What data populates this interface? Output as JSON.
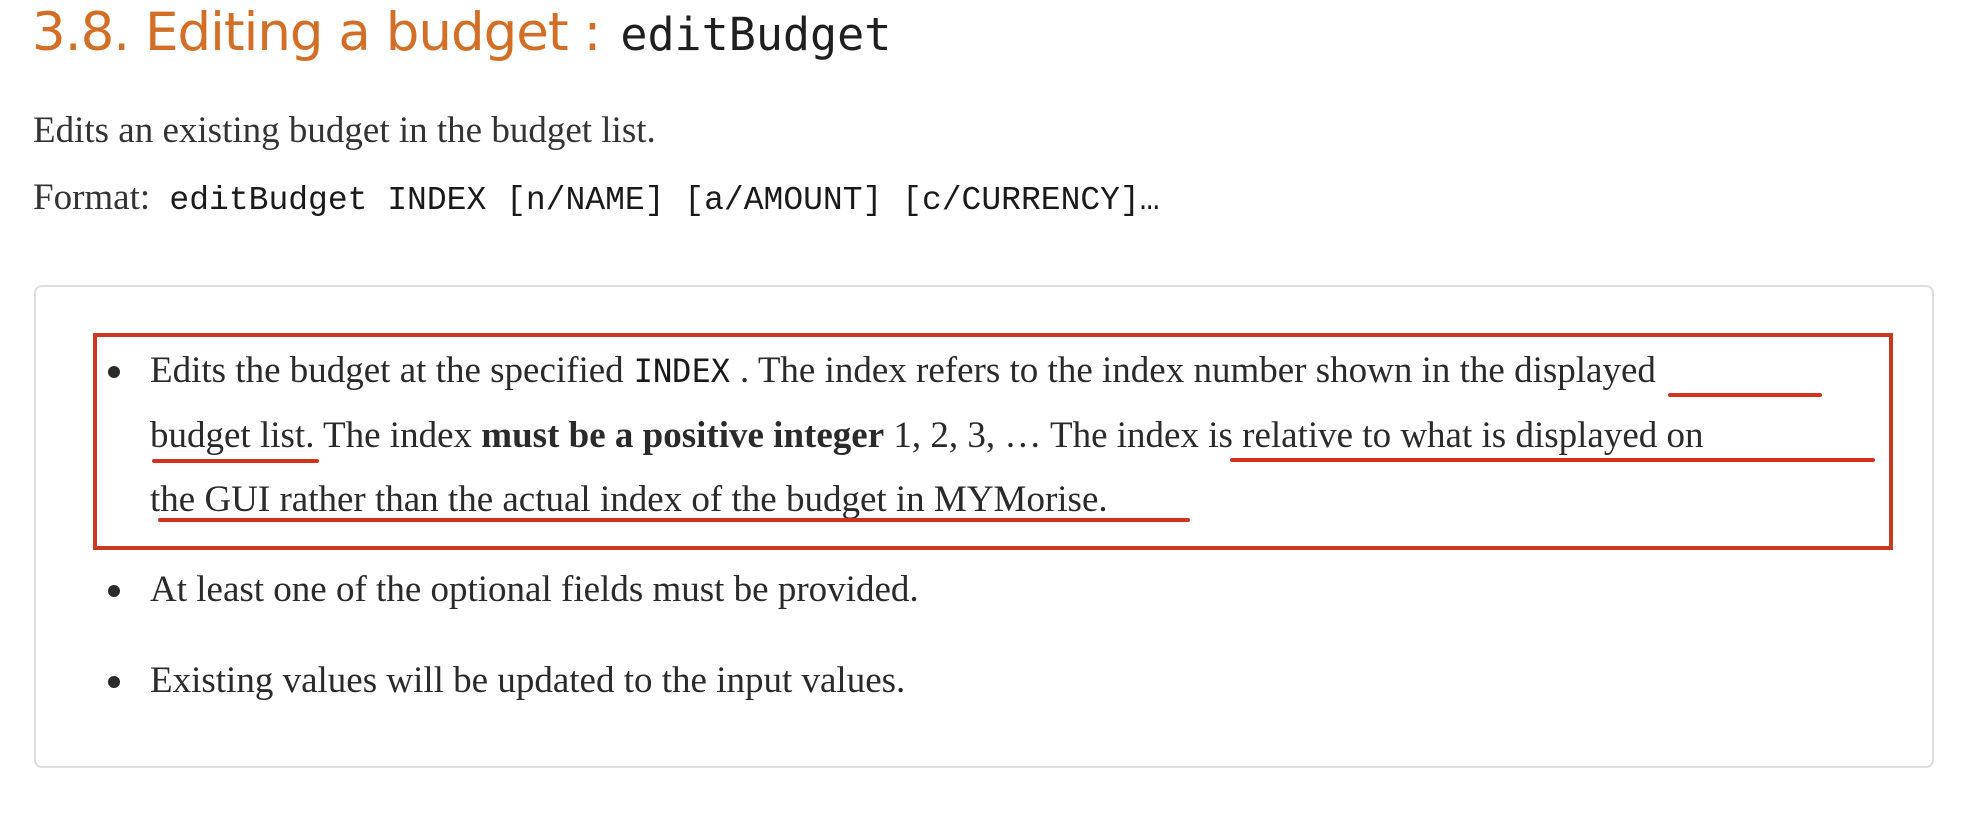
{
  "heading": {
    "text": "3.8. Editing a budget :",
    "code": "editBudget"
  },
  "description": "Edits an existing budget in the budget list.",
  "format": {
    "label": "Format:",
    "command": "editBudget INDEX [n/NAME] [a/AMOUNT] [c/CURRENCY]…"
  },
  "bullets": {
    "first": {
      "l1_pre": "Edits the budget at the specified",
      "l1_code": "INDEX",
      "l1_post": ". The index refers to the index number shown in the",
      "l1_ul": "displayed",
      "l2_ul": "budget list",
      "l2_mid": ". The index",
      "l2_bold": "must be a positive integer",
      "l2_nums": "1, 2, 3, …",
      "l2_the": "The",
      "l2_ul2": "index is relative to what is displayed on",
      "l3_ul": "the GUI rather than the actual index of the budget in MYMorise",
      "l3_end": "."
    },
    "second": "At least one of the optional fields must be provided.",
    "third": "Existing values will be updated to the input values."
  },
  "colors": {
    "heading": "#d36e26",
    "annotation": "#c93a22",
    "box_border": "#dedede"
  }
}
